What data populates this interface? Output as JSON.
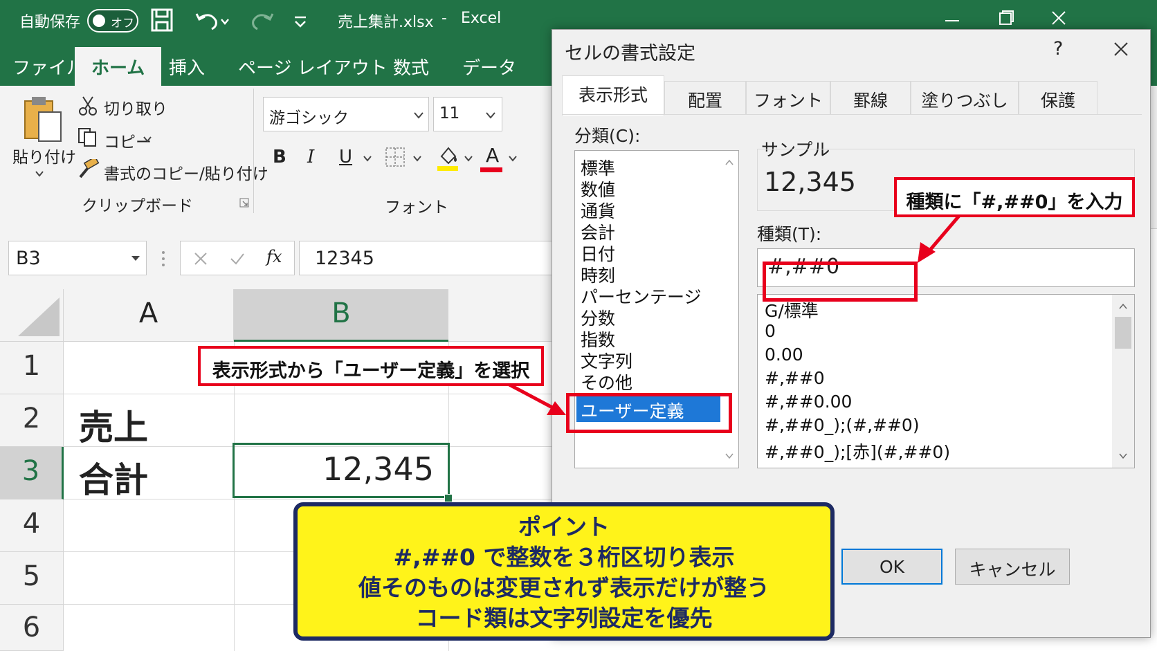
{
  "titlebar": {
    "autosave_label": "自動保存",
    "autosave_state": "オフ",
    "filename": "売上集計.xlsx",
    "dash": "-",
    "app_name": "Excel"
  },
  "ribbon_tabs": [
    "ファイル",
    "ホーム",
    "挿入",
    "ページ レイアウト",
    "数式",
    "データ"
  ],
  "clipboard": {
    "paste": "貼り付け",
    "cut": "切り取り",
    "copy": "コピー",
    "format_painter": "書式のコピー/貼り付け",
    "group_label": "クリップボード"
  },
  "font_group": {
    "font_name": "游ゴシック",
    "font_size": "11",
    "bold": "B",
    "italic": "I",
    "underline": "U",
    "font_color": "A",
    "group_label": "フォント"
  },
  "formula_bar": {
    "name_box": "B3",
    "fx": "fx",
    "value": "12345"
  },
  "sheet": {
    "columns": [
      "A",
      "B"
    ],
    "rows": [
      "1",
      "2",
      "3",
      "4",
      "5",
      "6"
    ],
    "a2": "売上",
    "a3": "合計",
    "b3": "12,345"
  },
  "dialog": {
    "title": "セルの書式設定",
    "help": "?",
    "tabs": [
      "表示形式",
      "配置",
      "フォント",
      "罫線",
      "塗りつぶし",
      "保護"
    ],
    "category_label": "分類(C):",
    "categories": [
      "標準",
      "数値",
      "通貨",
      "会計",
      "日付",
      "時刻",
      "パーセンテージ",
      "分数",
      "指数",
      "文字列",
      "その他",
      "ユーザー定義"
    ],
    "sample_label": "サンプル",
    "sample_value": "12,345",
    "type_label": "種類(T):",
    "type_value": "#,##0",
    "formats": [
      "G/標準",
      "0",
      "0.00",
      "#,##0",
      "#,##0.00",
      "#,##0_);(#,##0)",
      "#,##0_);[赤](#,##0)"
    ],
    "ok": "OK",
    "cancel": "キャンセル"
  },
  "annotations": {
    "select_user_defined": "表示形式から「ユーザー定義」を選択",
    "enter_type": "種類に「#,##0」を入力",
    "point_title": "ポイント",
    "point_lines": [
      "#,##0 で整数を３桁区切り表示",
      "値そのものは変更されず表示だけが整う",
      "コード類は文字列設定を優先"
    ]
  },
  "colors": {
    "excel_green": "#217346",
    "highlight_red": "#e8001c",
    "selection_blue": "#1e78d7",
    "point_yellow": "#fff31a",
    "point_navy": "#1d2a63"
  }
}
